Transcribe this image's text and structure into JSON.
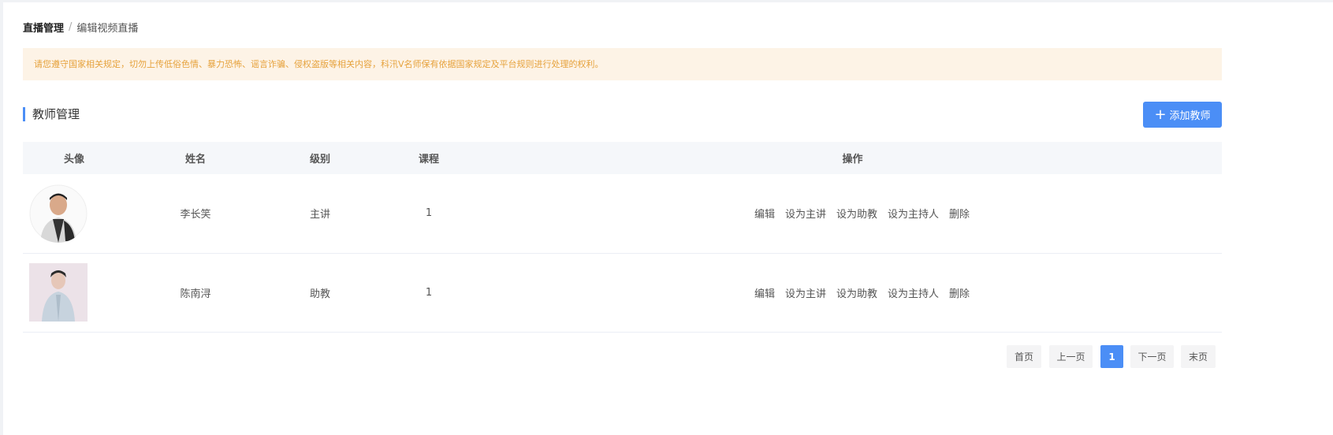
{
  "breadcrumb": {
    "parent": "直播管理",
    "separator": "/",
    "current": "编辑视频直播"
  },
  "notice": "请您遵守国家相关规定，切勿上传低俗色情、暴力恐怖、谣言诈骗、侵权盗版等相关内容，科汛V名师保有依据国家规定及平台规则进行处理的权利。",
  "section": {
    "title": "教师管理",
    "add_label": "添加教师"
  },
  "table": {
    "headers": {
      "avatar": "头像",
      "name": "姓名",
      "level": "级别",
      "course": "课程",
      "actions": "操作"
    },
    "rows": [
      {
        "name": "李长笑",
        "level": "主讲",
        "course": "1"
      },
      {
        "name": "陈南浔",
        "level": "助教",
        "course": "1"
      }
    ],
    "actions": {
      "edit": "编辑",
      "set_lecturer": "设为主讲",
      "set_assistant": "设为助教",
      "set_host": "设为主持人",
      "delete": "删除"
    }
  },
  "pagination": {
    "first": "首页",
    "prev": "上一页",
    "current": "1",
    "next": "下一页",
    "last": "末页"
  },
  "colors": {
    "accent": "#4b8ef6",
    "notice_bg": "#fdf3e6",
    "notice_text": "#e6a23c"
  }
}
